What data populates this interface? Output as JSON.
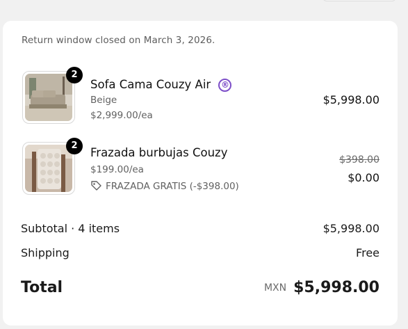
{
  "order": {
    "return_note": "Return window closed on March 3, 2026.",
    "items": [
      {
        "name": "Sofa Cama Couzy Air",
        "badge_icon": "registered-icon",
        "badge_glyph": "®",
        "variant": "Beige",
        "unit_price": "$2,999.00/ea",
        "quantity": "2",
        "price": "$5,998.00"
      },
      {
        "name": "Frazada burbujas Couzy",
        "unit_price": "$199.00/ea",
        "discount_icon": "tag-icon",
        "discount_label": "FRAZADA GRATIS",
        "discount_amount": "(-$398.00)",
        "quantity": "2",
        "original_price": "$398.00",
        "price": "$0.00"
      }
    ],
    "summary": {
      "subtotal_label": "Subtotal · 4 items",
      "subtotal_value": "$5,998.00",
      "shipping_label": "Shipping",
      "shipping_value": "Free",
      "total_label": "Total",
      "currency": "MXN",
      "total_value": "$5,998.00"
    },
    "colors": {
      "accent": "#7d4fc8",
      "badge": "#000000",
      "muted_text": "#616161"
    }
  }
}
